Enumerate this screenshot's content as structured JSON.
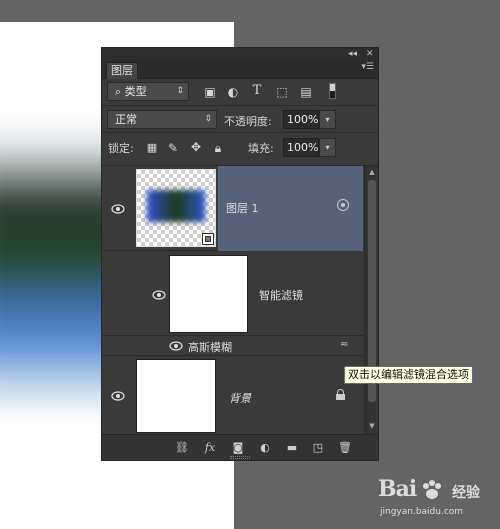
{
  "panel": {
    "tab_label": "图层",
    "filter_kind": "类型",
    "blend_mode": "正常",
    "opacity_label": "不透明度:",
    "opacity_value": "100%",
    "lock_label": "锁定:",
    "fill_label": "填充:",
    "fill_value": "100%",
    "filter_type_text_icon": "T"
  },
  "layers": [
    {
      "name": "图层 1",
      "kind": "smart-object",
      "selected": true
    },
    {
      "name": "智能滤镜",
      "kind": "smart-filter-mask"
    },
    {
      "name": "高斯模糊",
      "kind": "filter-entry"
    },
    {
      "name": "背景",
      "kind": "background",
      "locked": true
    }
  ],
  "tooltip": "双击以编辑滤镜混合选项",
  "bottom_fx_label": "fx",
  "watermark": {
    "logo": "Bai",
    "logo_suffix": "经验",
    "url": "jingyan.baidu.com"
  },
  "colors": {
    "panel_bg": "#3a3a3a",
    "selected_layer": "#56627a",
    "app_bg": "#646464",
    "tooltip_bg": "#ffffe1"
  }
}
